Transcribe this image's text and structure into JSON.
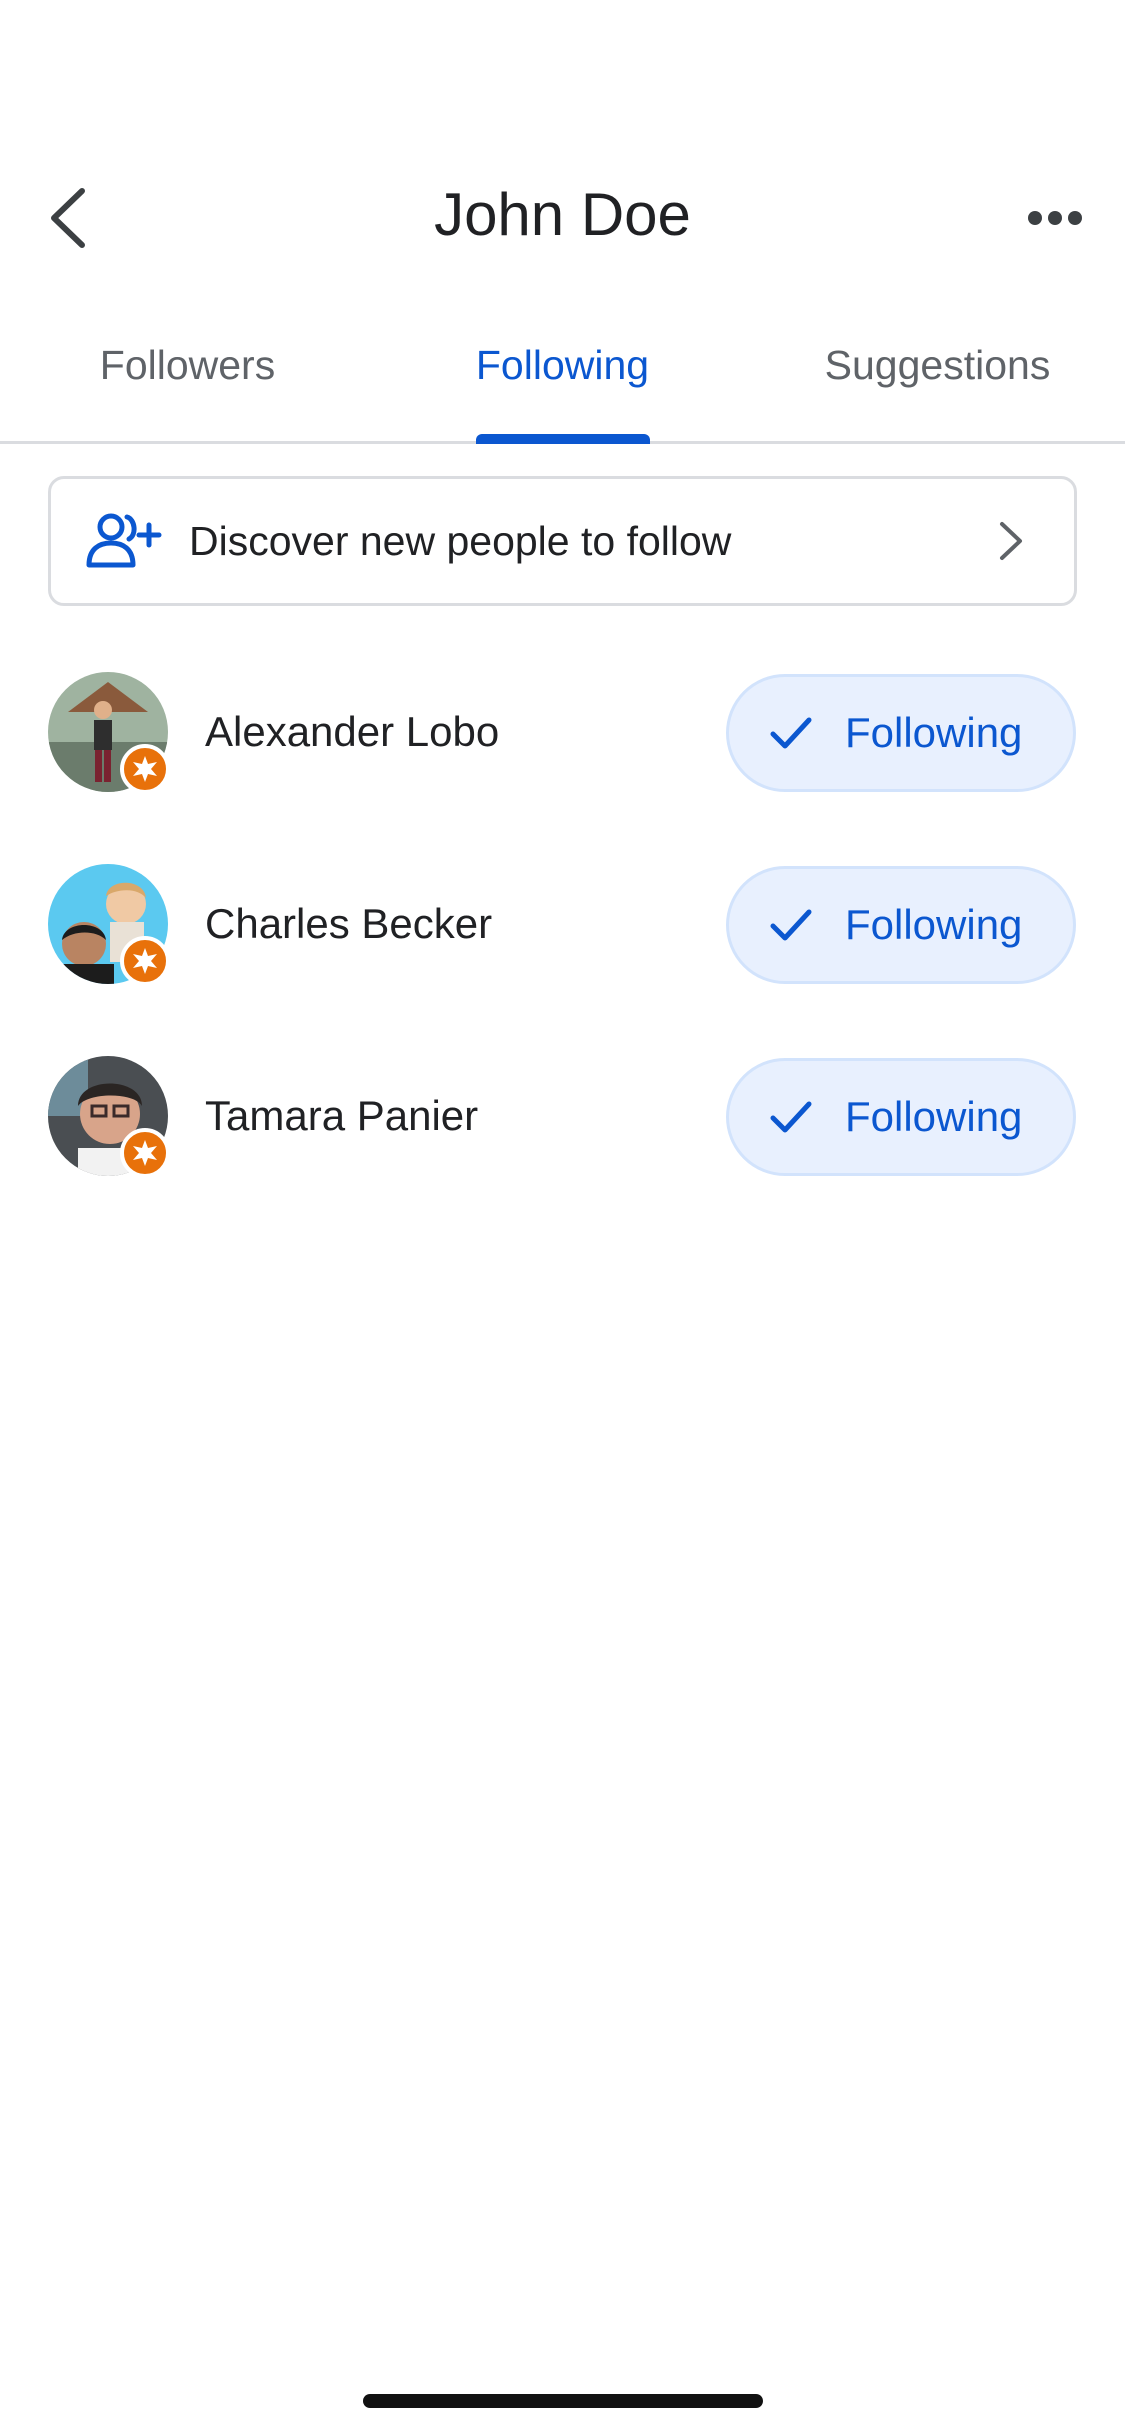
{
  "header": {
    "title": "John Doe",
    "back_icon": "chevron-left-icon",
    "more_icon": "more-horizontal-icon"
  },
  "tabs": [
    {
      "label": "Followers",
      "active": false
    },
    {
      "label": "Following",
      "active": true
    },
    {
      "label": "Suggestions",
      "active": false
    }
  ],
  "discover": {
    "label": "Discover new people to follow",
    "icon": "person-add-icon",
    "chevron": "chevron-right-icon"
  },
  "people": [
    {
      "name": "Alexander Lobo",
      "button_label": "Following"
    },
    {
      "name": "Charles Becker",
      "button_label": "Following"
    },
    {
      "name": "Tamara Panier",
      "button_label": "Following"
    }
  ],
  "colors": {
    "accent": "#0b57d0",
    "button_bg": "#e8f0fe",
    "badge": "#e8710a"
  }
}
